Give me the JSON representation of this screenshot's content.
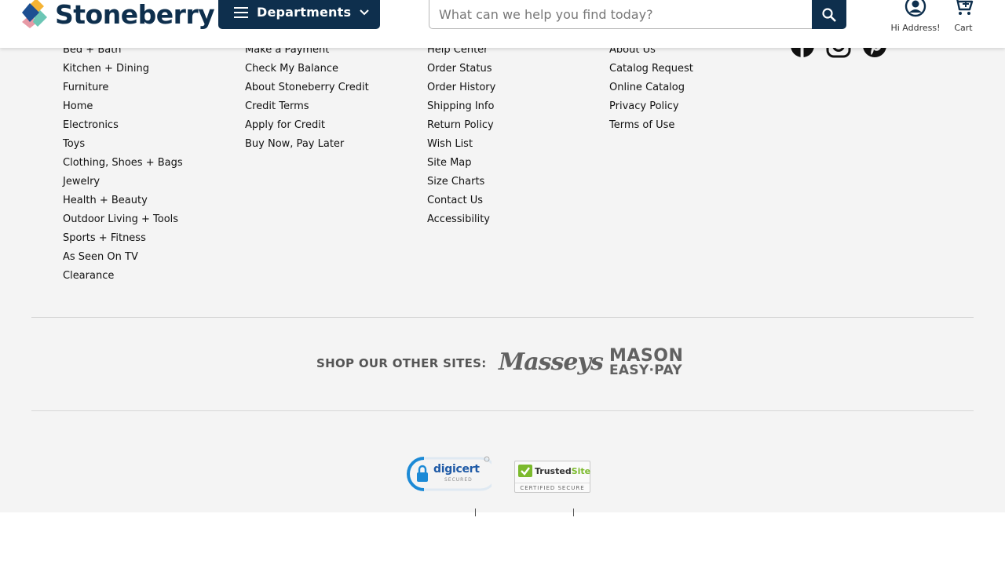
{
  "header": {
    "logo_text": "Stoneberry",
    "departments_label": "Departments",
    "search_placeholder": "What can we help you find today?",
    "account_label": "Hi Address!",
    "cart_label": "Cart"
  },
  "footer": {
    "columns": [
      {
        "links": [
          "Bed + Bath",
          "Kitchen + Dining",
          "Furniture",
          "Home",
          "Electronics",
          "Toys",
          "Clothing, Shoes + Bags",
          "Jewelry",
          "Health + Beauty",
          "Outdoor Living + Tools",
          "Sports + Fitness",
          "As Seen On TV",
          "Clearance"
        ]
      },
      {
        "links": [
          "Make a Payment",
          "Check My Balance",
          "About Stoneberry Credit",
          "Credit Terms",
          "Apply for Credit",
          "Buy Now, Pay Later"
        ]
      },
      {
        "links": [
          "Help Center",
          "Order Status",
          "Order History",
          "Shipping Info",
          "Return Policy",
          "Wish List",
          "Site Map",
          "Size Charts",
          "Contact Us",
          "Accessibility"
        ]
      },
      {
        "links": [
          "About Us",
          "Catalog Request",
          "Online Catalog",
          "Privacy Policy",
          "Terms of Use"
        ]
      }
    ],
    "social": [
      "facebook-icon",
      "instagram-icon",
      "pinterest-icon"
    ],
    "other_sites": {
      "label": "SHOP OUR OTHER SITES:",
      "sites": [
        "Masseys",
        "MASON",
        "EASY·PAY"
      ]
    },
    "badges": {
      "digicert_name": "digicert",
      "digicert_sub": "SECURED",
      "trusted_name_1": "Trusted",
      "trusted_name_2": "Site",
      "trusted_sub": "CERTIFIED SECURE"
    }
  },
  "colors": {
    "brand_navy": "#0e2f4d",
    "footer_bg": "#f4f4f4",
    "logo_blue": "#1d4f91",
    "logo_yellow": "#f5b335",
    "logo_pink": "#e79aa6",
    "logo_teal": "#6cc6b5"
  }
}
